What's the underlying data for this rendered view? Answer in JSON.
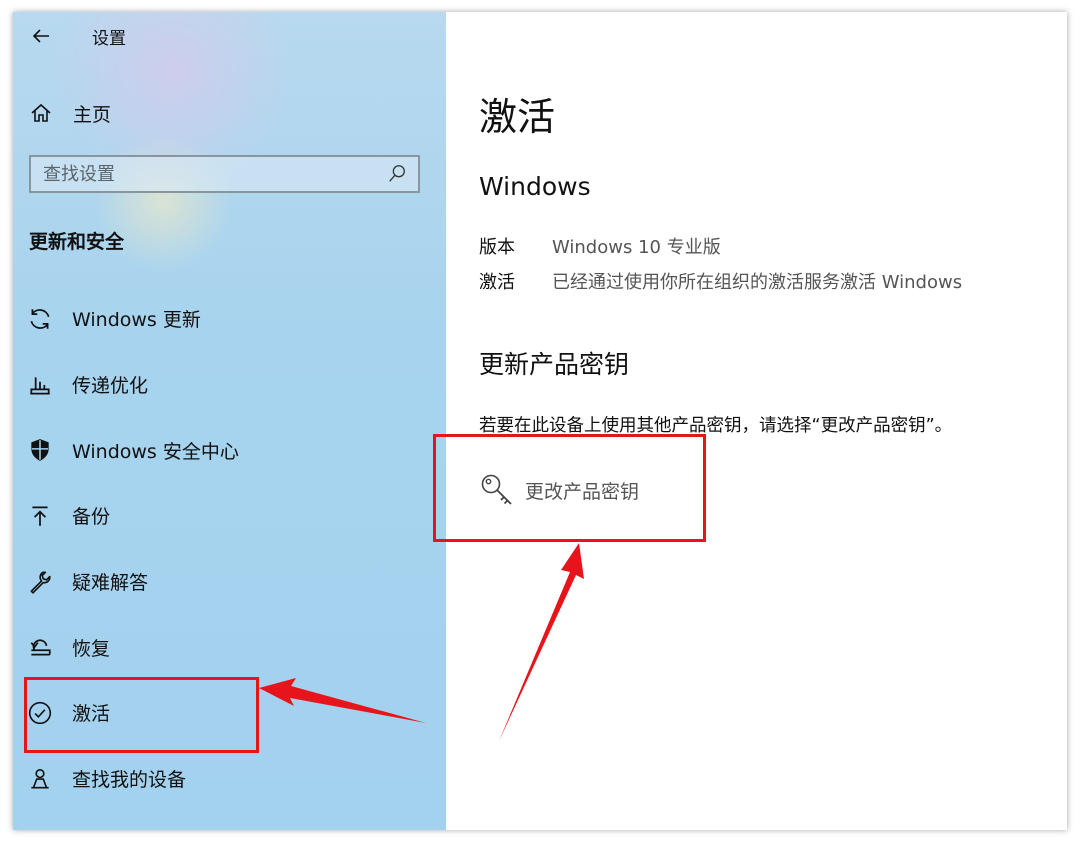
{
  "window": {
    "title": "设置"
  },
  "sidebar": {
    "home_label": "主页",
    "search_placeholder": "查找设置",
    "section_title": "更新和安全",
    "items": [
      {
        "label": "Windows 更新",
        "icon": "sync-icon"
      },
      {
        "label": "传递优化",
        "icon": "delivery-optimization-icon"
      },
      {
        "label": "Windows 安全中心",
        "icon": "shield-icon"
      },
      {
        "label": "备份",
        "icon": "backup-arrow-icon"
      },
      {
        "label": "疑难解答",
        "icon": "wrench-icon"
      },
      {
        "label": "恢复",
        "icon": "recovery-icon"
      },
      {
        "label": "激活",
        "icon": "check-circle-icon"
      },
      {
        "label": "查找我的设备",
        "icon": "person-locate-icon"
      }
    ]
  },
  "content": {
    "title": "激活",
    "windows_heading": "Windows",
    "edition_key": "版本",
    "edition_value": "Windows 10 专业版",
    "activation_key": "激活",
    "activation_value": "已经通过使用你所在组织的激活服务激活 Windows",
    "update_key_heading": "更新产品密钥",
    "update_key_description": "若要在此设备上使用其他产品密钥，请选择“更改产品密钥”。",
    "change_key_label": "更改产品密钥"
  },
  "colors": {
    "annotation_red": "#e8141c",
    "sidebar_blue": "#a3d2ee"
  }
}
